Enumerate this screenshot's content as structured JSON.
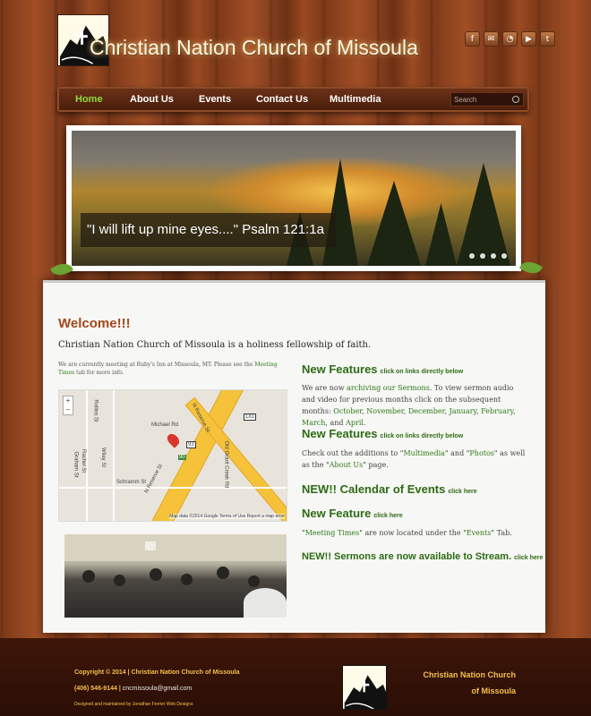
{
  "header": {
    "site_title": "Christian Nation Church of Missoula",
    "social_icons": [
      "facebook-icon",
      "email-icon",
      "rss-icon",
      "youtube-icon",
      "twitter-icon"
    ]
  },
  "nav": {
    "items": [
      {
        "label": "Home",
        "active": true
      },
      {
        "label": "About Us",
        "active": false
      },
      {
        "label": "Events",
        "active": false
      },
      {
        "label": "Contact Us",
        "active": false
      },
      {
        "label": "Multimedia",
        "active": false
      }
    ],
    "search_placeholder": "Search"
  },
  "slider": {
    "caption": "\"I will lift up mine eyes....\" Psalm 121:1a",
    "slide_count": 4
  },
  "main": {
    "welcome": "Welcome!!!",
    "intro": "Christian Nation Church of Missoula is a holiness fellowship of faith.",
    "note_prefix": "We are currently meeting at Ruby's Inn at Missoula, MT.  Please see the",
    "note_link": "Meeting Times",
    "note_suffix": "tab for more info.",
    "map": {
      "labels": [
        "Michael Rd",
        "N Reserve St",
        "Schramm St",
        "Old Grant Creek Rd",
        "Rollins St",
        "Wiley St",
        "Graham St",
        "Rachel St",
        "Mullan St"
      ],
      "footer": "Map data ©2014 Google   Terms of Use   Report a map error",
      "zoom_in": "+",
      "zoom_out": "−",
      "shield_93": "93",
      "shield_181": "181",
      "shield_90": "90"
    }
  },
  "features": [
    {
      "title": "New Features",
      "link": "click on links directly below"
    },
    {
      "title": "New Features",
      "link": "click on links directly below"
    },
    {
      "title": "NEW!! Calendar of Events",
      "link": "click here"
    },
    {
      "title": "New Feature",
      "link": "click here"
    },
    {
      "title": "NEW!! Sermons are now available to Stream.",
      "link": "click here"
    }
  ],
  "feature_texts": {
    "f1_a": "We are now",
    "f1_link": "archiving our Sermons",
    "f1_b": ".  To view sermon audio and video for previous months click on the subsequent months:",
    "months": [
      "October",
      "November",
      "December",
      "January",
      "February",
      "March",
      "April"
    ],
    "f2_a": "Check out the additions to \"",
    "f2_l1": "Multimedia",
    "f2_b": "\" and \"",
    "f2_l2": "Photos",
    "f2_c": "\" as well as the \"",
    "f2_l3": "About Us",
    "f2_d": "\" page.",
    "f4_a": "\"",
    "f4_l1": "Meeting Times",
    "f4_b": "\" are now located under the \"",
    "f4_l2": "Events",
    "f4_c": "\" Tab."
  },
  "footer": {
    "copyright": "Copyright © 2014 | Christian Nation Church of Missoula",
    "phone": "(406) 546-9144 |",
    "email": "cncmissoula@gmail.com",
    "designed": "Designed and maintained by Jonathan Ferrier Web Designs",
    "name_line1": "Christian Nation Church",
    "name_line2": "of Missoula"
  },
  "colors": {
    "accent_green": "#2d6b14",
    "brand_brown": "#a2481c",
    "footer_gold": "#f3c04e"
  }
}
